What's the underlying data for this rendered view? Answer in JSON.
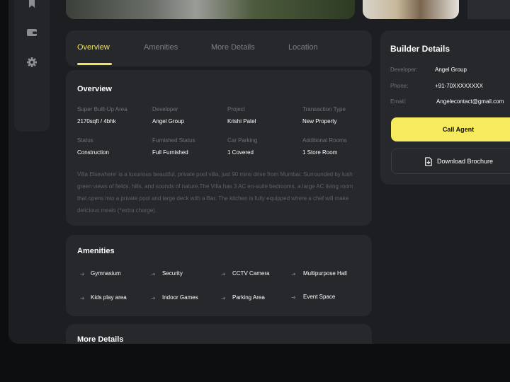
{
  "tabs": [
    {
      "label": "Overview",
      "active": true
    },
    {
      "label": "Amenities"
    },
    {
      "label": "More Details"
    },
    {
      "label": "Location"
    }
  ],
  "overview": {
    "title": "Overview",
    "fields": [
      {
        "label": "Super Built-Up Area",
        "value": "2170sqft / 4bhk"
      },
      {
        "label": "Developer",
        "value": "Angel Group"
      },
      {
        "label": "Project",
        "value": "Krishi Patel"
      },
      {
        "label": "Transaction Type",
        "value": "New Property"
      },
      {
        "label": "Status",
        "value": "Construction"
      },
      {
        "label": "Furnished Status",
        "value": "Full Furnished"
      },
      {
        "label": "Car Parking",
        "value": "1 Covered"
      },
      {
        "label": "Additional Rooms",
        "value": "1 Store Room"
      }
    ],
    "description": "Villa Elsewhere' is a luxurious beautiful, private pool villa, just 90 mins drive from Mumbai. Surrounded by lush green views of fields, hills, and sounds of nature.The Villa has 3 AC en-suite bedrooms, a large AC living room that opens into a private pool and large deck with a Bar. The kitchen is fully equipped where a chef will make delicious meals (*extra charge)."
  },
  "amenities": {
    "title": "Amenities",
    "items": [
      "Gymnasium",
      "Security",
      "CCTV Camera",
      "Multipurpose Hall",
      "Kids play area",
      "Indoor Games",
      "Parking Area",
      "Event Space"
    ]
  },
  "more_details": {
    "title": "More Details"
  },
  "builder": {
    "title": "Builder Details",
    "developer_label": "Developer:",
    "developer": "Angel Group",
    "phone_label": "Phone:",
    "phone": "+91-70XXXXXXXX",
    "email_label": "Email:",
    "email": "Angelecontact@gmail.com",
    "call_label": "Call Agent",
    "download_label": "Download Brochure"
  },
  "sidebar_icons": [
    "bookmark-icon",
    "wallet-icon",
    "gear-icon"
  ]
}
